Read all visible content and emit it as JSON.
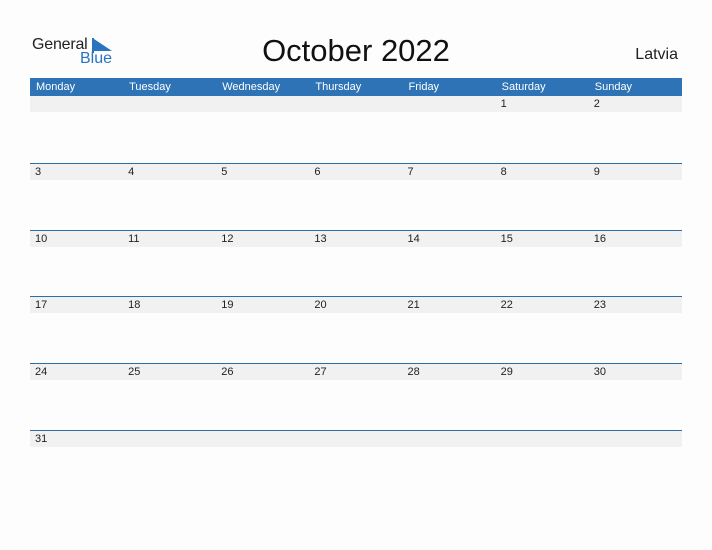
{
  "logo": {
    "general": "General",
    "blue": "Blue",
    "accent_color": "#2a74bf"
  },
  "title": "October 2022",
  "country": "Latvia",
  "colors": {
    "header_bg": "#2e73b5",
    "row_border": "#2e6da8",
    "date_strip": "#f1f1f1"
  },
  "weekdays": [
    "Monday",
    "Tuesday",
    "Wednesday",
    "Thursday",
    "Friday",
    "Saturday",
    "Sunday"
  ],
  "weeks": [
    [
      "",
      "",
      "",
      "",
      "",
      "1",
      "2"
    ],
    [
      "3",
      "4",
      "5",
      "6",
      "7",
      "8",
      "9"
    ],
    [
      "10",
      "11",
      "12",
      "13",
      "14",
      "15",
      "16"
    ],
    [
      "17",
      "18",
      "19",
      "20",
      "21",
      "22",
      "23"
    ],
    [
      "24",
      "25",
      "26",
      "27",
      "28",
      "29",
      "30"
    ],
    [
      "31",
      "",
      "",
      "",
      "",
      "",
      ""
    ]
  ]
}
